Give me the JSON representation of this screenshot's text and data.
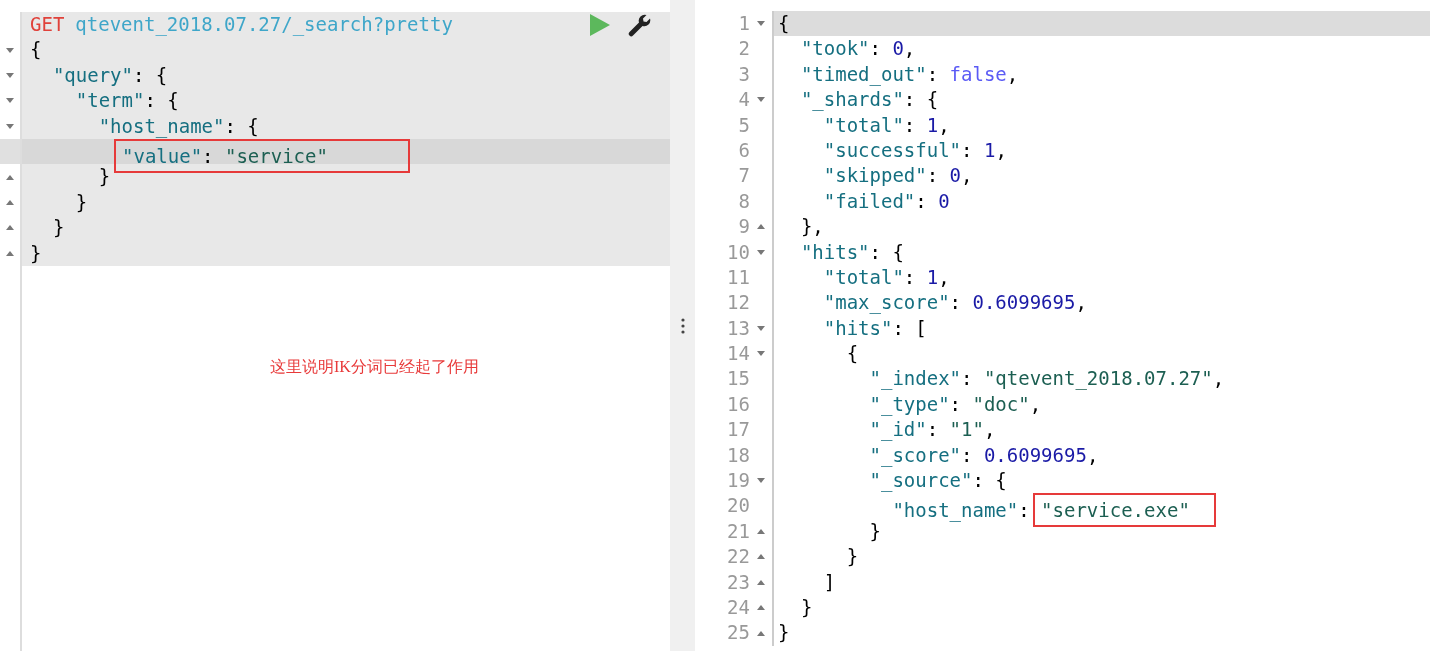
{
  "request": {
    "method": "GET",
    "path": "qtevent_2018.07.27/_search?pretty",
    "lines": [
      {
        "kind": "open",
        "active": false,
        "tokens": [
          {
            "kind": "punct",
            "text": "{"
          }
        ]
      },
      {
        "kind": "open",
        "active": false,
        "tokens": [
          {
            "kind": "key",
            "text": "  \"query\""
          },
          {
            "kind": "punct",
            "text": ": {"
          }
        ]
      },
      {
        "kind": "open",
        "active": false,
        "tokens": [
          {
            "kind": "key",
            "text": "    \"term\""
          },
          {
            "kind": "punct",
            "text": ": {"
          }
        ]
      },
      {
        "kind": "open",
        "active": false,
        "tokens": [
          {
            "kind": "key",
            "text": "      \"host_name\""
          },
          {
            "kind": "punct",
            "text": ": {"
          }
        ]
      },
      {
        "kind": "plain",
        "active": true,
        "tokens": [
          {
            "kind": "box",
            "tokens": [
              {
                "kind": "key",
                "text": "\"value\""
              },
              {
                "kind": "punct",
                "text": ": "
              },
              {
                "kind": "string",
                "text": "\"service\""
              }
            ]
          }
        ]
      },
      {
        "kind": "close",
        "active": false,
        "tokens": [
          {
            "kind": "punct",
            "text": "      }"
          }
        ]
      },
      {
        "kind": "close",
        "active": false,
        "tokens": [
          {
            "kind": "punct",
            "text": "    }"
          }
        ]
      },
      {
        "kind": "close",
        "active": false,
        "tokens": [
          {
            "kind": "punct",
            "text": "  }"
          }
        ]
      },
      {
        "kind": "close",
        "active": false,
        "tokens": [
          {
            "kind": "punct",
            "text": "}"
          }
        ]
      }
    ]
  },
  "note": "这里说明IK分词已经起了作用",
  "response": {
    "lines": [
      {
        "number": "1",
        "kind": "open",
        "active": true,
        "tokens": [
          {
            "kind": "punct",
            "text": "{"
          }
        ]
      },
      {
        "number": "2",
        "kind": "plain",
        "active": false,
        "tokens": [
          {
            "kind": "key",
            "text": "  \"took\""
          },
          {
            "kind": "punct",
            "text": ": "
          },
          {
            "kind": "number",
            "text": "0"
          },
          {
            "kind": "punct",
            "text": ","
          }
        ]
      },
      {
        "number": "3",
        "kind": "plain",
        "active": false,
        "tokens": [
          {
            "kind": "key",
            "text": "  \"timed_out\""
          },
          {
            "kind": "punct",
            "text": ": "
          },
          {
            "kind": "boolean",
            "text": "false"
          },
          {
            "kind": "punct",
            "text": ","
          }
        ]
      },
      {
        "number": "4",
        "kind": "open",
        "active": false,
        "tokens": [
          {
            "kind": "key",
            "text": "  \"_shards\""
          },
          {
            "kind": "punct",
            "text": ": {"
          }
        ]
      },
      {
        "number": "5",
        "kind": "plain",
        "active": false,
        "tokens": [
          {
            "kind": "key",
            "text": "    \"total\""
          },
          {
            "kind": "punct",
            "text": ": "
          },
          {
            "kind": "number",
            "text": "1"
          },
          {
            "kind": "punct",
            "text": ","
          }
        ]
      },
      {
        "number": "6",
        "kind": "plain",
        "active": false,
        "tokens": [
          {
            "kind": "key",
            "text": "    \"successful\""
          },
          {
            "kind": "punct",
            "text": ": "
          },
          {
            "kind": "number",
            "text": "1"
          },
          {
            "kind": "punct",
            "text": ","
          }
        ]
      },
      {
        "number": "7",
        "kind": "plain",
        "active": false,
        "tokens": [
          {
            "kind": "key",
            "text": "    \"skipped\""
          },
          {
            "kind": "punct",
            "text": ": "
          },
          {
            "kind": "number",
            "text": "0"
          },
          {
            "kind": "punct",
            "text": ","
          }
        ]
      },
      {
        "number": "8",
        "kind": "plain",
        "active": false,
        "tokens": [
          {
            "kind": "key",
            "text": "    \"failed\""
          },
          {
            "kind": "punct",
            "text": ": "
          },
          {
            "kind": "number",
            "text": "0"
          }
        ]
      },
      {
        "number": "9",
        "kind": "close",
        "active": false,
        "tokens": [
          {
            "kind": "punct",
            "text": "  },"
          }
        ]
      },
      {
        "number": "10",
        "kind": "open",
        "active": false,
        "tokens": [
          {
            "kind": "key",
            "text": "  \"hits\""
          },
          {
            "kind": "punct",
            "text": ": {"
          }
        ]
      },
      {
        "number": "11",
        "kind": "plain",
        "active": false,
        "tokens": [
          {
            "kind": "key",
            "text": "    \"total\""
          },
          {
            "kind": "punct",
            "text": ": "
          },
          {
            "kind": "number",
            "text": "1"
          },
          {
            "kind": "punct",
            "text": ","
          }
        ]
      },
      {
        "number": "12",
        "kind": "plain",
        "active": false,
        "tokens": [
          {
            "kind": "key",
            "text": "    \"max_score\""
          },
          {
            "kind": "punct",
            "text": ": "
          },
          {
            "kind": "number",
            "text": "0.6099695"
          },
          {
            "kind": "punct",
            "text": ","
          }
        ]
      },
      {
        "number": "13",
        "kind": "open",
        "active": false,
        "tokens": [
          {
            "kind": "key",
            "text": "    \"hits\""
          },
          {
            "kind": "punct",
            "text": ": ["
          }
        ]
      },
      {
        "number": "14",
        "kind": "open",
        "active": false,
        "tokens": [
          {
            "kind": "punct",
            "text": "      {"
          }
        ]
      },
      {
        "number": "15",
        "kind": "plain",
        "active": false,
        "tokens": [
          {
            "kind": "key",
            "text": "        \"_index\""
          },
          {
            "kind": "punct",
            "text": ": "
          },
          {
            "kind": "string",
            "text": "\"qtevent_2018.07.27\""
          },
          {
            "kind": "punct",
            "text": ","
          }
        ]
      },
      {
        "number": "16",
        "kind": "plain",
        "active": false,
        "tokens": [
          {
            "kind": "key",
            "text": "        \"_type\""
          },
          {
            "kind": "punct",
            "text": ": "
          },
          {
            "kind": "string",
            "text": "\"doc\""
          },
          {
            "kind": "punct",
            "text": ","
          }
        ]
      },
      {
        "number": "17",
        "kind": "plain",
        "active": false,
        "tokens": [
          {
            "kind": "key",
            "text": "        \"_id\""
          },
          {
            "kind": "punct",
            "text": ": "
          },
          {
            "kind": "string",
            "text": "\"1\""
          },
          {
            "kind": "punct",
            "text": ","
          }
        ]
      },
      {
        "number": "18",
        "kind": "plain",
        "active": false,
        "tokens": [
          {
            "kind": "key",
            "text": "        \"_score\""
          },
          {
            "kind": "punct",
            "text": ": "
          },
          {
            "kind": "number",
            "text": "0.6099695"
          },
          {
            "kind": "punct",
            "text": ","
          }
        ]
      },
      {
        "number": "19",
        "kind": "open",
        "active": false,
        "tokens": [
          {
            "kind": "key",
            "text": "        \"_source\""
          },
          {
            "kind": "punct",
            "text": ": {"
          }
        ]
      },
      {
        "number": "20",
        "kind": "plain",
        "active": false,
        "tokens": [
          {
            "kind": "key",
            "text": "          \"host_name\""
          },
          {
            "kind": "punct",
            "text": ": "
          },
          {
            "kind": "box",
            "tokens": [
              {
                "kind": "string",
                "text": "\"service.exe\""
              }
            ]
          }
        ]
      },
      {
        "number": "21",
        "kind": "close",
        "active": false,
        "tokens": [
          {
            "kind": "punct",
            "text": "        }"
          }
        ]
      },
      {
        "number": "22",
        "kind": "close",
        "active": false,
        "tokens": [
          {
            "kind": "punct",
            "text": "      }"
          }
        ]
      },
      {
        "number": "23",
        "kind": "close",
        "active": false,
        "tokens": [
          {
            "kind": "punct",
            "text": "    ]"
          }
        ]
      },
      {
        "number": "24",
        "kind": "close",
        "active": false,
        "tokens": [
          {
            "kind": "punct",
            "text": "  }"
          }
        ]
      },
      {
        "number": "25",
        "kind": "close",
        "active": false,
        "tokens": [
          {
            "kind": "punct",
            "text": "}"
          }
        ]
      }
    ]
  }
}
